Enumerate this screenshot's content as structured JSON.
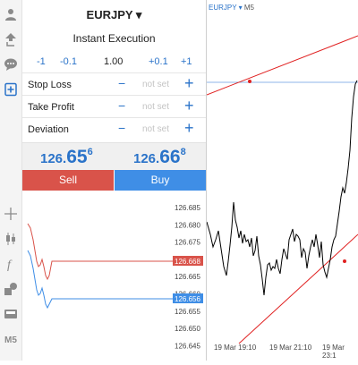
{
  "toolbar": {
    "items": [
      {
        "name": "user-icon"
      },
      {
        "name": "trade-arrows-icon"
      },
      {
        "name": "chat-icon"
      },
      {
        "name": "new-order-icon"
      },
      {
        "name": "crosshair-icon"
      },
      {
        "name": "candles-icon"
      },
      {
        "name": "indicators-icon"
      },
      {
        "name": "objects-icon"
      },
      {
        "name": "templates-icon"
      }
    ],
    "timeframe_label": "M5"
  },
  "order": {
    "symbol": "EURJPY ▾",
    "execution": "Instant Execution",
    "lot_buttons": [
      "-1",
      "-0.1",
      "1.00",
      "+0.1",
      "+1"
    ],
    "rows": [
      {
        "label": "Stop Loss",
        "minus": "−",
        "value": "not set",
        "plus": "+"
      },
      {
        "label": "Take Profit",
        "minus": "−",
        "value": "not set",
        "plus": "+"
      },
      {
        "label": "Deviation",
        "minus": "−",
        "value": "not set",
        "plus": "+"
      }
    ],
    "bid": {
      "prefix": "126.",
      "big": "65",
      "sup": "6"
    },
    "ask": {
      "prefix": "126.",
      "big": "66",
      "sup": "8"
    },
    "sell_label": "Sell",
    "buy_label": "Buy"
  },
  "tick_chart": {
    "price_labels": [
      "126.685",
      "126.680",
      "126.675",
      "126.670",
      "126.665",
      "126.660",
      "126.655",
      "126.650",
      "126.645"
    ],
    "bid_tag": "126.656",
    "ask_tag": "126.668",
    "ask_color": "#d9534a",
    "bid_color": "#3f8ee6"
  },
  "chart": {
    "symbol": "EURJPY",
    "arrow": " ▾ ",
    "timeframe": "M5",
    "time_labels": [
      "19 Mar 19:10",
      "19 Mar 21:10",
      "19 Mar 23:1"
    ],
    "line_color": "#000000",
    "trend_color": "#e02020",
    "hline_color": "#8fb6e8"
  },
  "colors": {
    "accent": "#2a73c9",
    "sell": "#d9534a",
    "buy": "#3f8ee6"
  }
}
